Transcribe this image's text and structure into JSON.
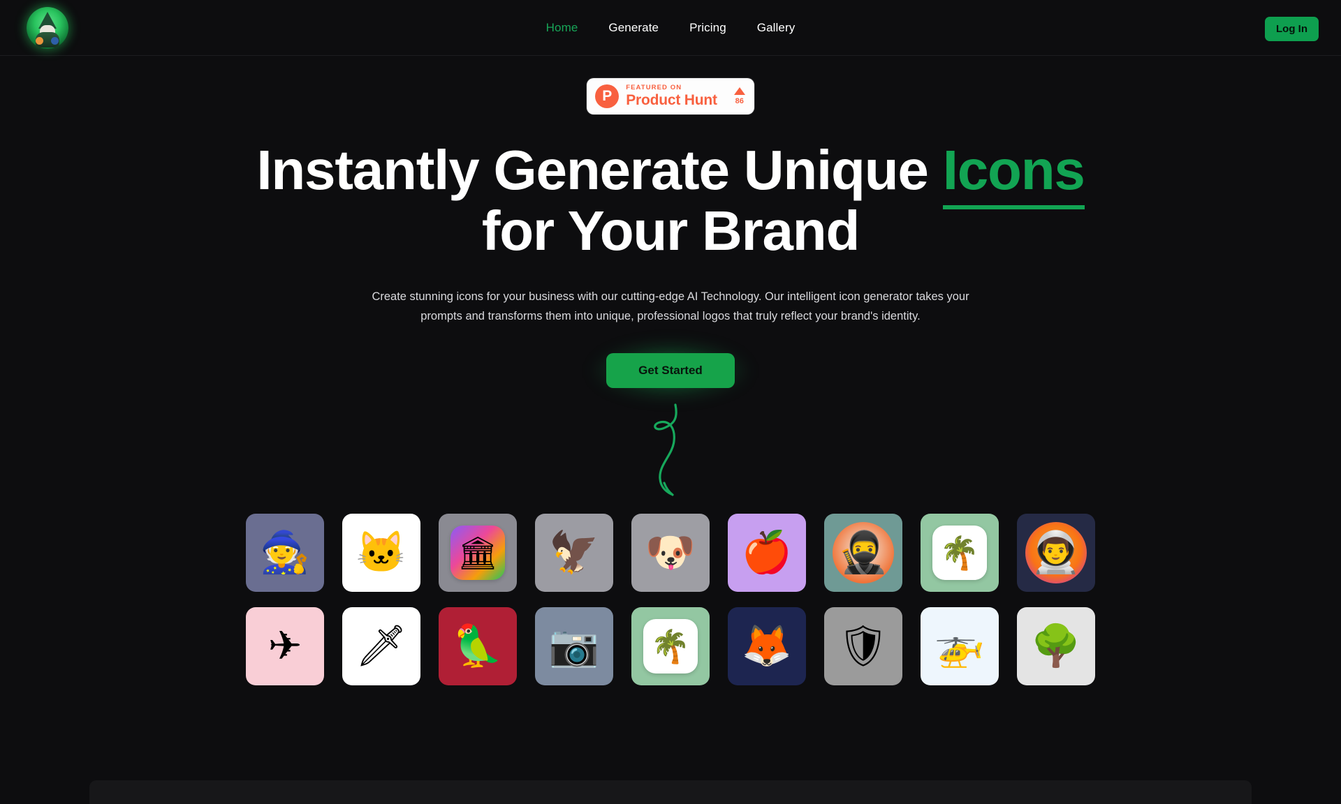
{
  "brand": {
    "logo_icon": "wizard-gnome-avatar-icon"
  },
  "nav": {
    "links": [
      {
        "label": "Home",
        "active": true
      },
      {
        "label": "Generate",
        "active": false
      },
      {
        "label": "Pricing",
        "active": false
      },
      {
        "label": "Gallery",
        "active": false
      }
    ],
    "login_label": "Log In"
  },
  "hero": {
    "badge": {
      "logo_letter": "P",
      "featured_on": "FEATURED ON",
      "product_name": "Product Hunt",
      "vote_count": "86",
      "upvote_icon": "triangle-up-icon"
    },
    "headline_part1": "Instantly Generate Unique ",
    "headline_accent": "Icons",
    "headline_part2": " for Your Brand",
    "subtitle": "Create stunning icons for your business with our cutting-edge AI Technology. Our intelligent icon generator takes your prompts and transforms them into unique, professional logos that truly reflect your brand's identity.",
    "cta_label": "Get Started",
    "arrow_icon": "curly-down-arrow-icon"
  },
  "showcase": {
    "rows": [
      [
        {
          "name": "wizard-icon",
          "glyph": "🧙",
          "bg": "#6a6e91",
          "style": "plain"
        },
        {
          "name": "cat-icon",
          "glyph": "🐱",
          "bg": "#ffffff",
          "style": "plain"
        },
        {
          "name": "bank-building-icon",
          "glyph": "🏛",
          "bg": "#8a8a92",
          "style": "gradient-card"
        },
        {
          "name": "red-bird-icon",
          "glyph": "🦅",
          "bg": "#9c9ca3",
          "style": "plain"
        },
        {
          "name": "puppy-dog-icon",
          "glyph": "🐶",
          "bg": "#9e9ea4",
          "style": "plain"
        },
        {
          "name": "apple-fruit-icon",
          "glyph": "🍎",
          "bg": "#c79ff0",
          "style": "plain"
        },
        {
          "name": "soldier-avatar-icon",
          "glyph": "🥷",
          "bg": "#6f9a95",
          "style": "circle"
        },
        {
          "name": "palm-tree-icon",
          "glyph": "🌴",
          "bg": "#93c7a2",
          "style": "white-card"
        },
        {
          "name": "astronaut-icon",
          "glyph": "👨‍🚀",
          "bg": "#252a45",
          "style": "circle-sunset"
        }
      ],
      [
        {
          "name": "airplane-icon",
          "glyph": "✈",
          "bg": "#f9ced6",
          "style": "plain"
        },
        {
          "name": "sword-dagger-icon",
          "glyph": "🗡",
          "bg": "#ffffff",
          "style": "plain"
        },
        {
          "name": "parrot-icon",
          "glyph": "🦜",
          "bg": "#b01f35",
          "style": "plain"
        },
        {
          "name": "camera-icon",
          "glyph": "📷",
          "bg": "#7d8ba0",
          "style": "plain"
        },
        {
          "name": "palm-tree-icon",
          "glyph": "🌴",
          "bg": "#93c7a2",
          "style": "white-card"
        },
        {
          "name": "fox-icon",
          "glyph": "🦊",
          "bg": "#1d2550",
          "style": "plain"
        },
        {
          "name": "shield-icon",
          "glyph": "🛡",
          "bg": "#9b9b9b",
          "style": "plain"
        },
        {
          "name": "helicopter-icon",
          "glyph": "🚁",
          "bg": "#eef6fd",
          "style": "plain"
        },
        {
          "name": "tree-icon",
          "glyph": "🌳",
          "bg": "#e4e4e4",
          "style": "plain"
        }
      ]
    ]
  },
  "colors": {
    "page_bg": "#0d0d0f",
    "accent_green": "#12a453",
    "button_green": "#16a34a",
    "product_hunt_orange": "#f8603f",
    "text_primary": "#ffffff",
    "text_muted": "#d9d9dd"
  }
}
